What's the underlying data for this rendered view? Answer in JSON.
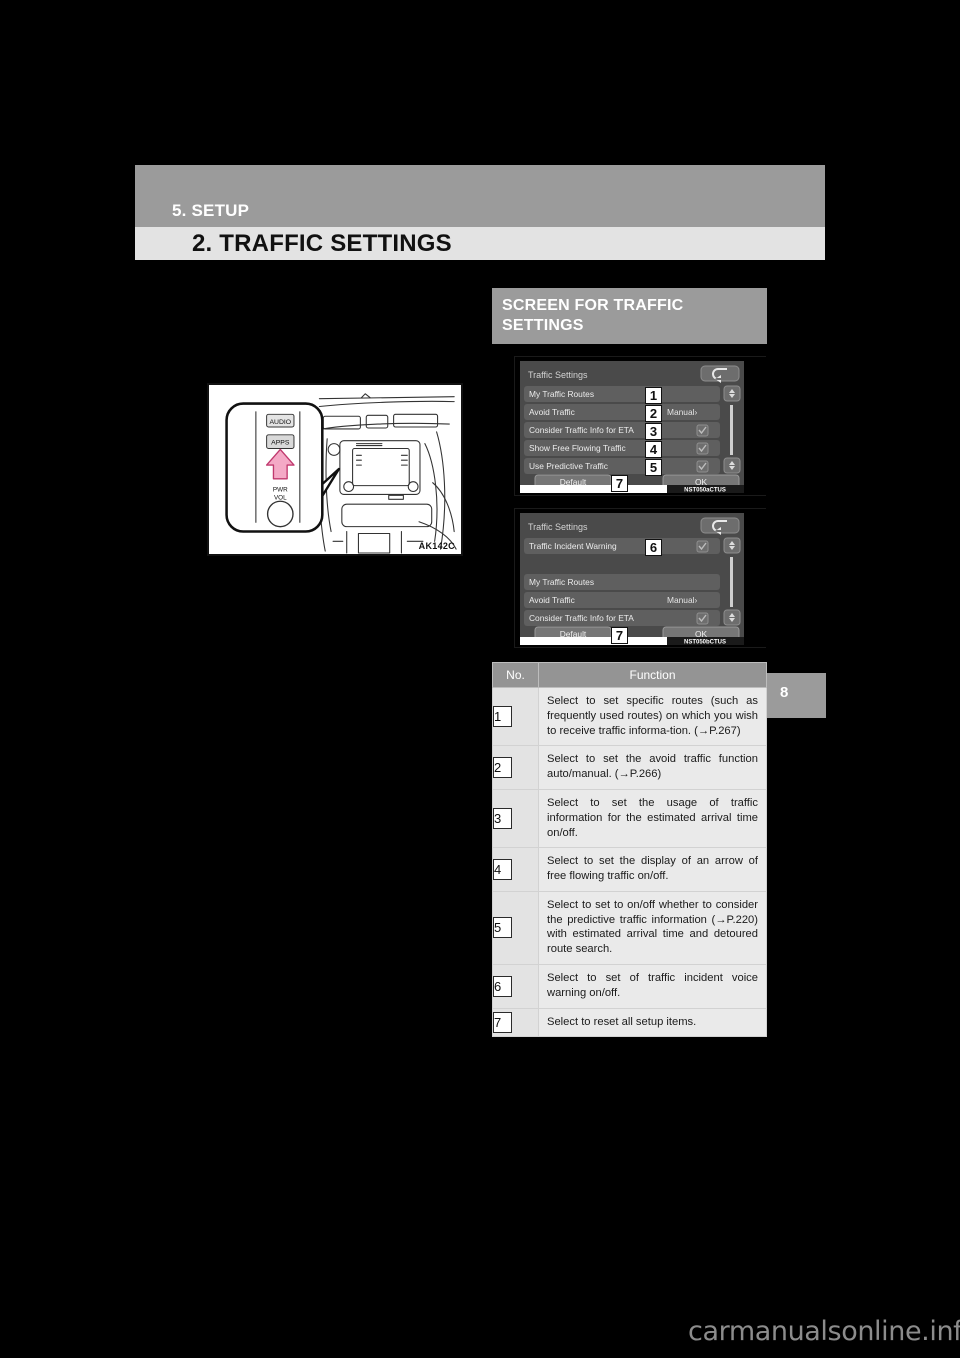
{
  "page": {
    "chapter_label": "5. SETUP",
    "section_title": "2. TRAFFIC SETTINGS",
    "chapter_tab_number": "8",
    "watermark": "carmanualsonline.info"
  },
  "illustration": {
    "name": "audio-control-panel-dashboard",
    "code": "AK142C",
    "buttons": [
      {
        "label": "AUDIO"
      },
      {
        "label": "APPS"
      }
    ],
    "knob_label_line1": "PWR",
    "knob_label_line2": "VOL"
  },
  "subhead": {
    "line1": "SCREEN FOR TRAFFIC",
    "line2": "SETTINGS"
  },
  "screens": [
    {
      "code": "NST050aCTUS",
      "title": "Traffic Settings",
      "back_icon": "back-arrow-icon",
      "rows": [
        {
          "label": "My Traffic Routes",
          "value": "",
          "control": "none",
          "callout": "1"
        },
        {
          "label": "Avoid Traffic",
          "value": "Manual>",
          "control": "value",
          "callout": "2"
        },
        {
          "label": "Consider Traffic Info for ETA",
          "value": "",
          "control": "checkbox",
          "checked": true,
          "callout": "3"
        },
        {
          "label": "Show Free Flowing Traffic",
          "value": "",
          "control": "checkbox",
          "checked": true,
          "callout": "4"
        },
        {
          "label": "Use Predictive Traffic",
          "value": "",
          "control": "checkbox",
          "checked": true,
          "callout": "5"
        }
      ],
      "buttons": [
        {
          "label": "Default",
          "callout": "7"
        },
        {
          "label": "OK",
          "callout": ""
        }
      ]
    },
    {
      "code": "NST050bCTUS",
      "title": "Traffic Settings",
      "back_icon": "back-arrow-icon",
      "rows": [
        {
          "label": "Traffic Incident Warning",
          "value": "",
          "control": "checkbox",
          "checked": true,
          "callout": "6"
        },
        {
          "label": "",
          "value": "",
          "control": "none",
          "callout": ""
        },
        {
          "label": "My Traffic Routes",
          "value": "",
          "control": "none",
          "callout": ""
        },
        {
          "label": "Avoid Traffic",
          "value": "Manual>",
          "control": "value",
          "callout": ""
        },
        {
          "label": "Consider Traffic Info for ETA",
          "value": "",
          "control": "checkbox",
          "checked": true,
          "callout": ""
        }
      ],
      "buttons": [
        {
          "label": "Default",
          "callout": "7"
        },
        {
          "label": "OK",
          "callout": ""
        }
      ]
    }
  ],
  "table": {
    "headers": {
      "no": "No.",
      "function": "Function"
    },
    "rows": [
      {
        "no": "1",
        "text": "Select to set specific routes (such as frequently used routes) on which you wish to receive traffic informa-tion. (→P.267)"
      },
      {
        "no": "2",
        "text": "Select to set the avoid traffic function auto/manual. (→P.266)"
      },
      {
        "no": "3",
        "text": "Select to set the usage of traffic information for the estimated arrival time on/off."
      },
      {
        "no": "4",
        "text": "Select to set the display of an arrow of free flowing traffic on/off."
      },
      {
        "no": "5",
        "text": "Select to set to on/off whether to consider the predictive traffic information (→P.220) with estimated arrival time and detoured route search."
      },
      {
        "no": "6",
        "text": "Select to set of traffic incident voice warning on/off."
      },
      {
        "no": "7",
        "text": "Select to reset all setup items."
      }
    ]
  }
}
